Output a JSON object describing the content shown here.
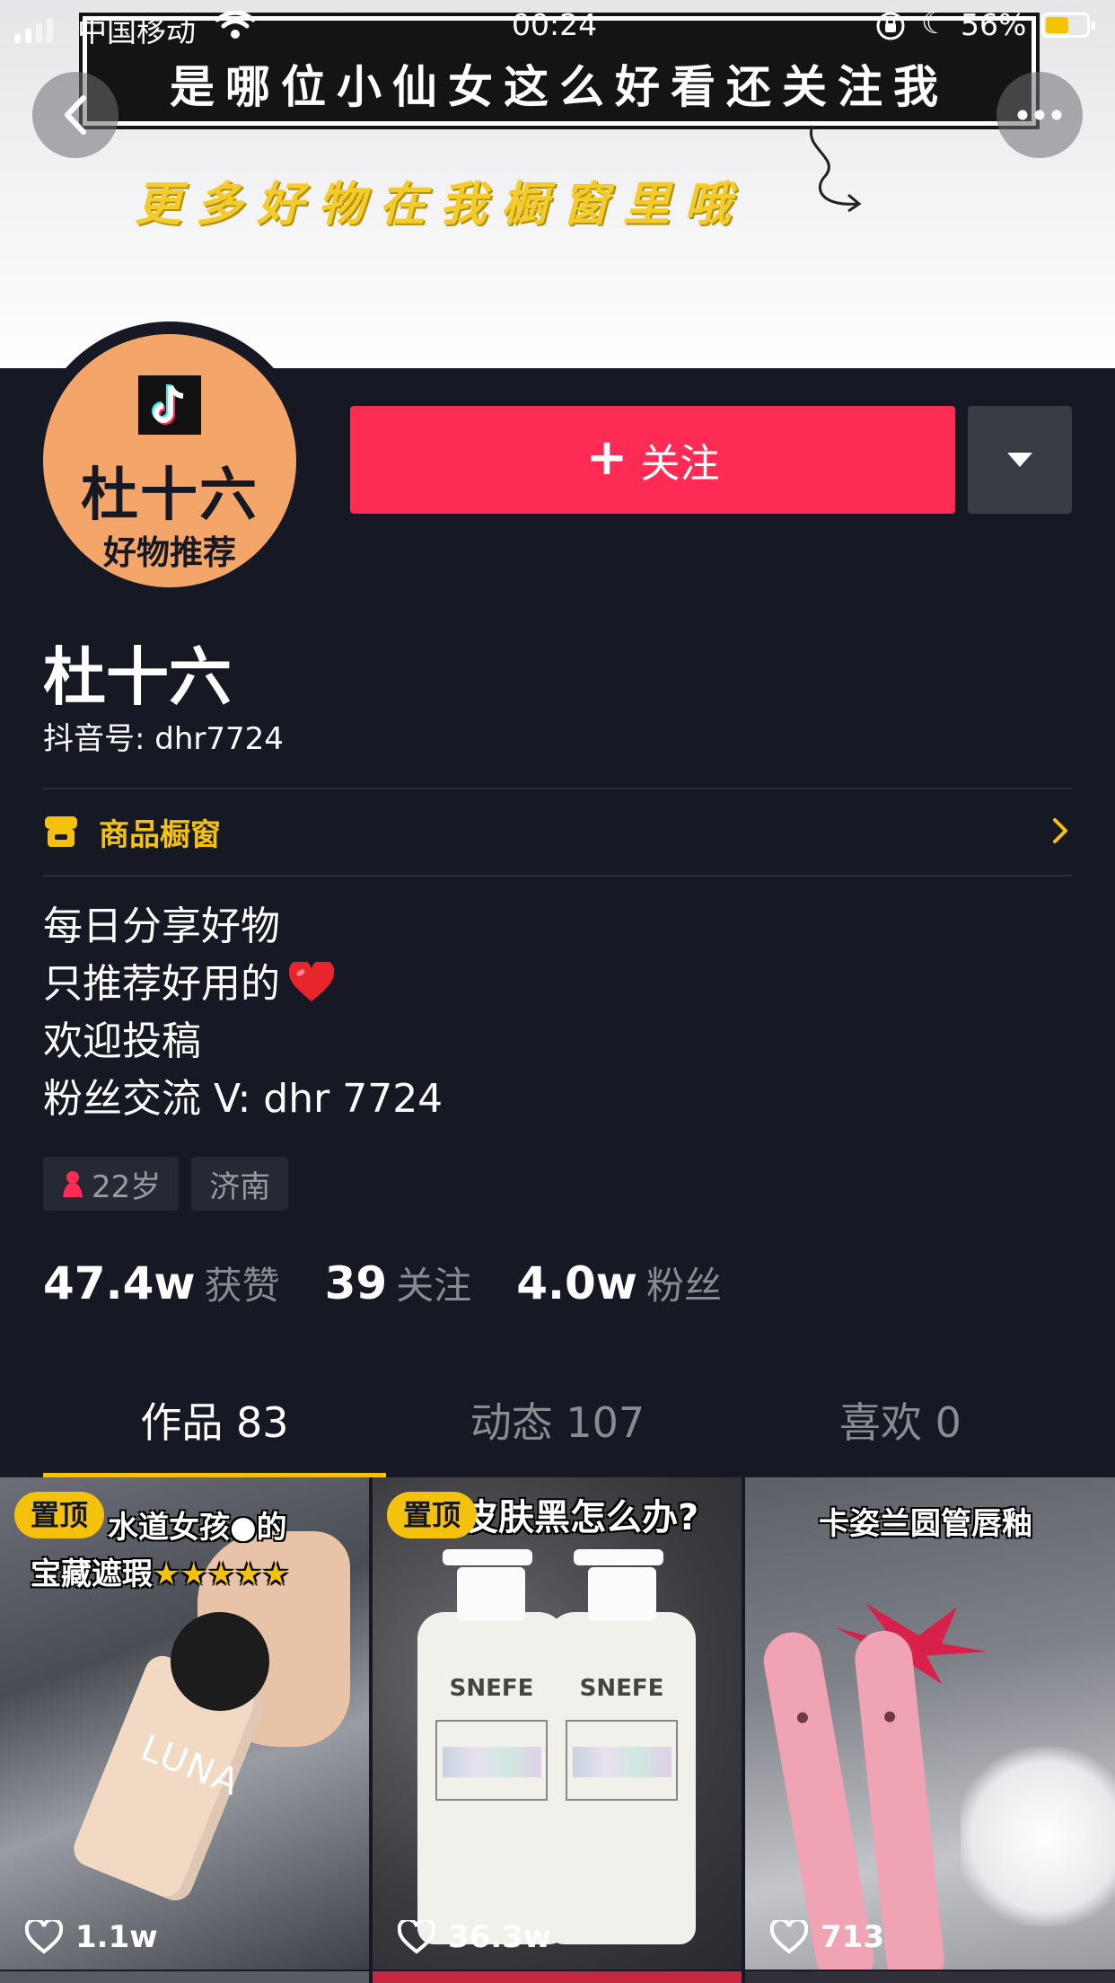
{
  "status_bar": {
    "carrier": "中国移动",
    "time": "00:24",
    "battery": "56%",
    "battery_level": 0.56
  },
  "banner": {
    "slogan": "是哪位小仙女这么好看还关注我",
    "sub_slogan": "更多好物在我橱窗里哦"
  },
  "avatar": {
    "name": "杜十六",
    "subtitle": "好物推荐"
  },
  "actions": {
    "follow_label": "关注"
  },
  "profile": {
    "display_name": "杜十六",
    "douyin_id": "抖音号: dhr7724",
    "shop_label": "商品橱窗",
    "bio": [
      "每日分享好物",
      "只推荐好用的",
      "欢迎投稿",
      "粉丝交流 V: dhr 7724"
    ],
    "age_tag": "22岁",
    "location_tag": "济南"
  },
  "stats": [
    {
      "num": "47.4w",
      "label": "获赞"
    },
    {
      "num": "39",
      "label": "关注"
    },
    {
      "num": "4.0w",
      "label": "粉丝"
    }
  ],
  "tabs": [
    {
      "label": "作品 83"
    },
    {
      "label": "动态 107"
    },
    {
      "label": "喜欢 0"
    }
  ],
  "videos": [
    {
      "pin": "置顶",
      "caption_1": "水道女孩",
      "caption_emoji": "的",
      "caption_2": "宝藏遮瑕",
      "bottle_text": "LUNA",
      "likes": "1.1w"
    },
    {
      "pin": "置顶",
      "caption_1": "皮肤黑怎么办?",
      "brand": "SNEFE",
      "likes": "36.3w"
    },
    {
      "caption_1": "卡姿兰圆管唇釉",
      "likes": "713"
    }
  ],
  "colors": {
    "background": "#161823",
    "accent": "#fe2c55",
    "highlight": "#f4c20d",
    "avatar_bg": "#f4a66a"
  }
}
